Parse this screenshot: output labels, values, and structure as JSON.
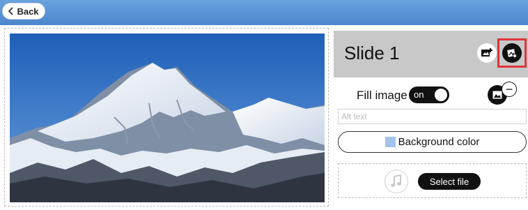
{
  "topbar": {
    "back_label": "Back"
  },
  "slide": {
    "title": "Slide 1",
    "fill_image_label": "Fill image",
    "toggle_state": "on",
    "alt_text_placeholder": "Alt text",
    "background_color_label": "Background color",
    "background_color_swatch": "#a4c3ea",
    "select_file_label": "Select file"
  },
  "colors": {
    "topbar": "#5b95d6",
    "highlight": "#e0343a"
  },
  "icons": {
    "back": "chevron-left-icon",
    "add_image": "add-image-icon",
    "image_settings": "image-settings-icon",
    "image": "image-icon",
    "remove": "minus-icon",
    "music": "music-note-icon"
  }
}
